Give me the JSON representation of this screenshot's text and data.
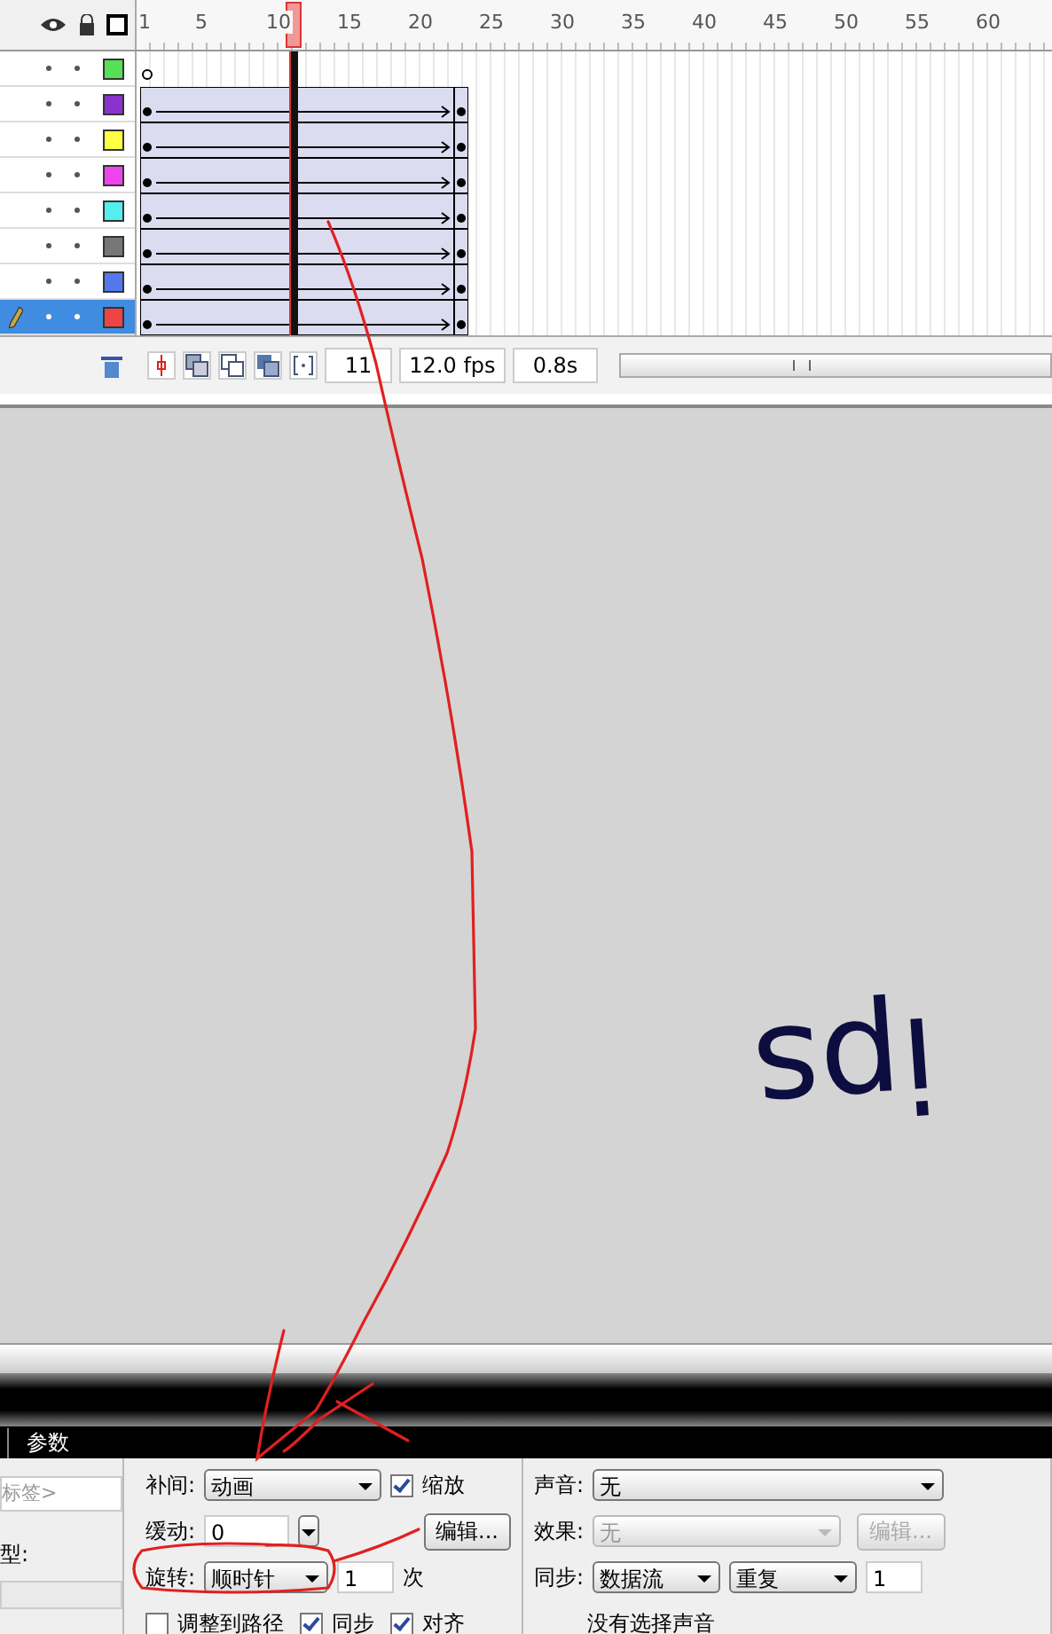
{
  "timeline": {
    "ruler": [
      "1",
      "5",
      "10",
      "15",
      "20",
      "25",
      "30",
      "35",
      "40",
      "45",
      "50",
      "55",
      "60"
    ],
    "layers": [
      {
        "kind": "empty",
        "color": "#55e055",
        "selected": false
      },
      {
        "kind": "tween",
        "color": "#8833cc",
        "selected": false
      },
      {
        "kind": "tween",
        "color": "#ffff44",
        "selected": false
      },
      {
        "kind": "tween",
        "color": "#ee44ee",
        "selected": false
      },
      {
        "kind": "tween",
        "color": "#55eeee",
        "selected": false
      },
      {
        "kind": "tween",
        "color": "#777777",
        "selected": false
      },
      {
        "kind": "tween",
        "color": "#5577ee",
        "selected": false
      },
      {
        "kind": "tween",
        "color": "#ee4444",
        "selected": true
      }
    ],
    "status": {
      "frame": "11",
      "fps": "12.0 fps",
      "time": "0.8s"
    }
  },
  "stage": {
    "text": "ips"
  },
  "properties": {
    "tab": "参数",
    "label_placeholder": "标签>",
    "type_label": "型:",
    "tween": {
      "label": "补间:",
      "value": "动画",
      "scale": {
        "label": "缩放",
        "checked": true
      }
    },
    "ease": {
      "label": "缓动:",
      "value": "0",
      "edit": "编辑..."
    },
    "rotate": {
      "label": "旋转:",
      "value": "顺时针",
      "count": "1",
      "unit": "次"
    },
    "options": [
      {
        "label": "调整到路径",
        "checked": false
      },
      {
        "label": "同步",
        "checked": true
      },
      {
        "label": "对齐",
        "checked": true
      }
    ],
    "sound": {
      "label": "声音:",
      "value": "无"
    },
    "effect": {
      "label": "效果:",
      "value": "无",
      "disabled": true,
      "edit": "编辑..."
    },
    "sync": {
      "label": "同步:",
      "value": "数据流",
      "repeat": "重复",
      "count": "1"
    },
    "note": "没有选择声音"
  }
}
